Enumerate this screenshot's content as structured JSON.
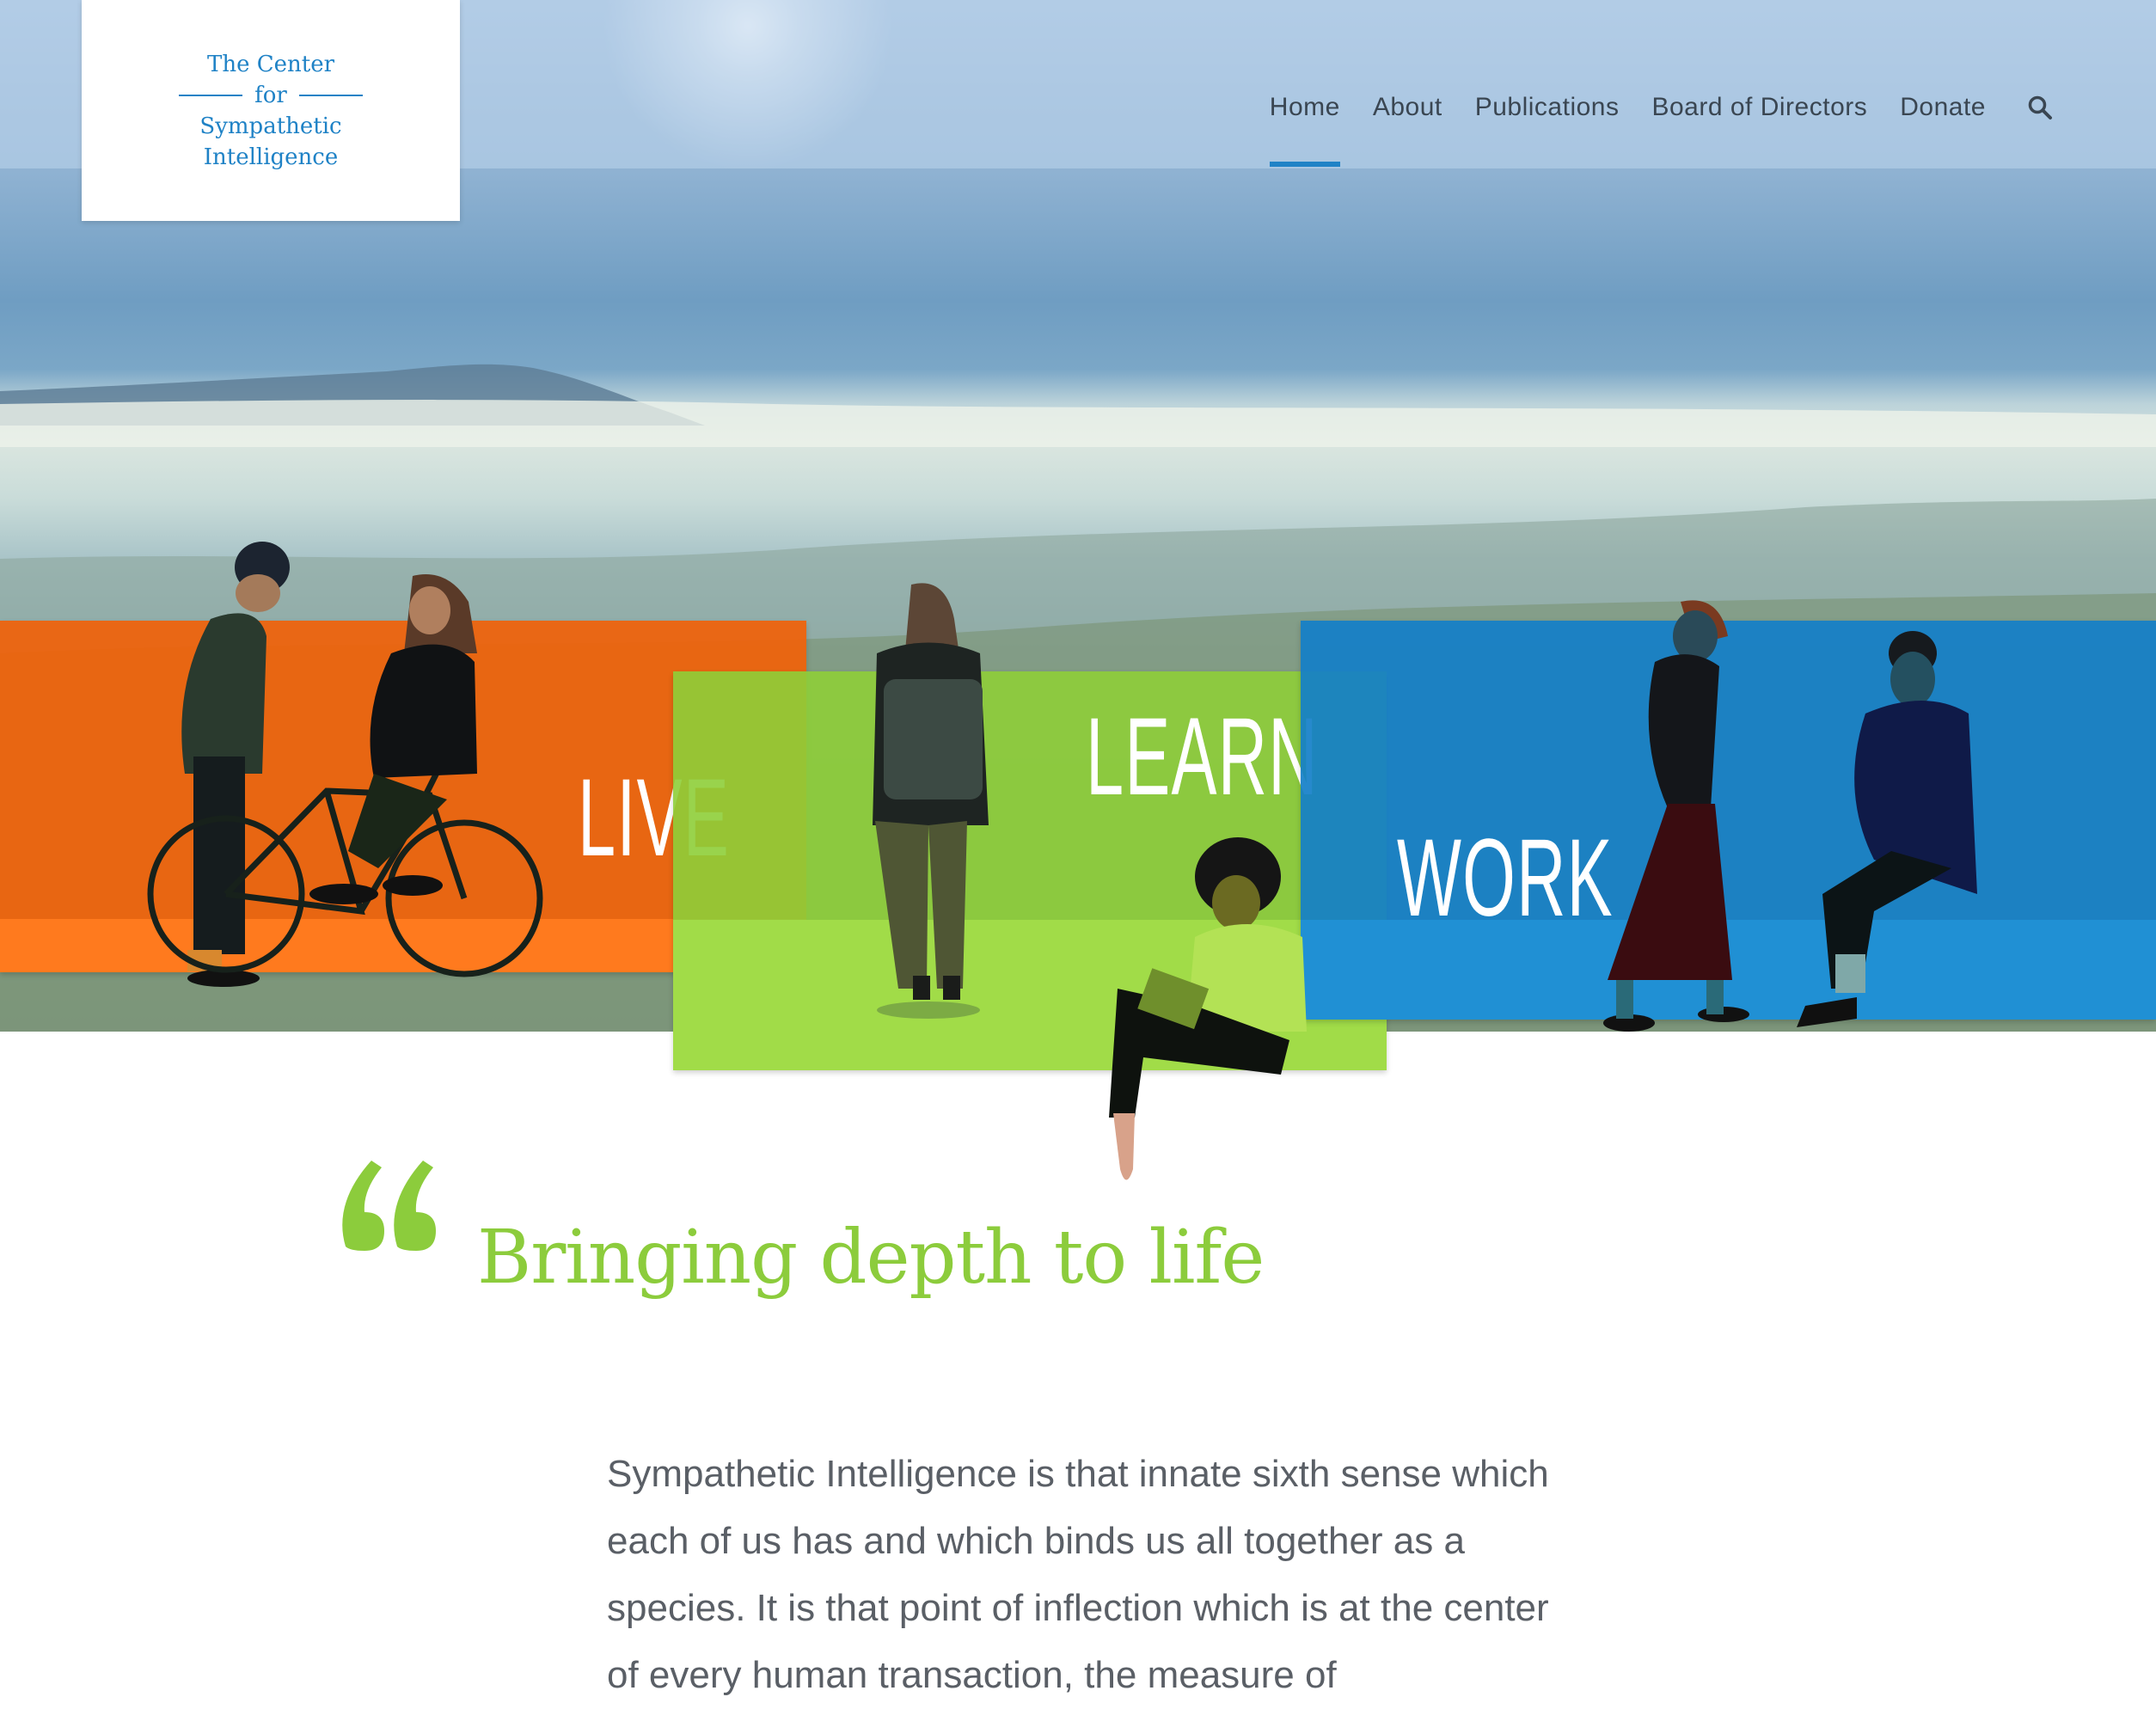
{
  "logo": {
    "line1": "The Center",
    "line2": "for",
    "line3": "Sympathetic",
    "line4": "Intelligence"
  },
  "nav": {
    "items": [
      {
        "label": "Home",
        "active": true
      },
      {
        "label": "About",
        "active": false
      },
      {
        "label": "Publications",
        "active": false
      },
      {
        "label": "Board of Directors",
        "active": false
      },
      {
        "label": "Donate",
        "active": false
      }
    ],
    "search_icon": "search-icon"
  },
  "panels": {
    "live": {
      "label": "LIVE",
      "color": "#f0620a"
    },
    "learn": {
      "label": "LEARN",
      "color": "#8ece38"
    },
    "work": {
      "label": "WORK",
      "color": "#147fc8"
    }
  },
  "quote": {
    "mark_icon": "quote-mark-icon",
    "tagline": "Bringing depth to life",
    "color": "#8ccc3c"
  },
  "body": {
    "paragraph": "Sympathetic Intelligence is that innate sixth sense which each of us has and which binds us all together as a species. It is that point of inflection which is at the center of every human transaction, the measure of"
  },
  "colors": {
    "accent": "#1f82c6",
    "nav_text": "#3a4652",
    "body_text": "#5a5f66"
  }
}
